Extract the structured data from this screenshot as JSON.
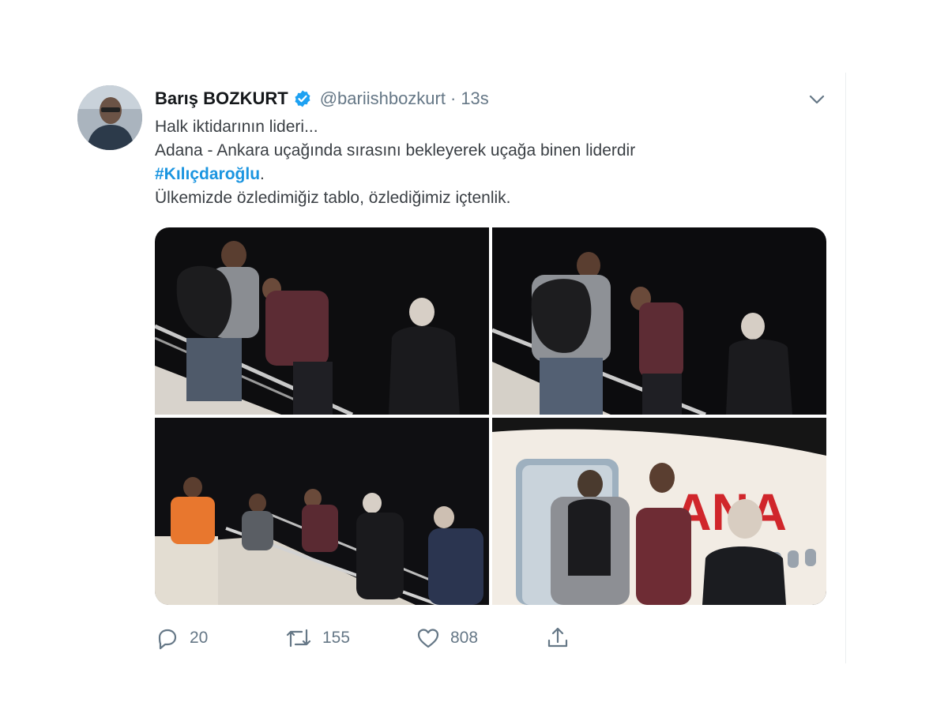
{
  "tweet": {
    "display_name": "Barış BOZKURT",
    "handle": "@bariishbozkurt",
    "separator": "·",
    "time": "13s",
    "text_line1": "Halk iktidarının lideri...",
    "text_line2": "Adana - Ankara uçağında sırasını bekleyerek uçağa binen liderdir",
    "hashtag": "#Kılıçdaroğlu",
    "hashtag_suffix": ".",
    "text_line4": "Ülkemizde özledimiğiz tablo, özlediğimiz içtenlik.",
    "airline_text": "ANA"
  },
  "actions": {
    "reply_count": "20",
    "retweet_count": "155",
    "like_count": "808"
  },
  "colors": {
    "link": "#1b95e0",
    "muted": "#657786",
    "verified": "#1da1f2"
  },
  "icons": [
    "verified-badge-icon",
    "chevron-down-icon",
    "reply-icon",
    "retweet-icon",
    "like-icon",
    "share-icon"
  ]
}
